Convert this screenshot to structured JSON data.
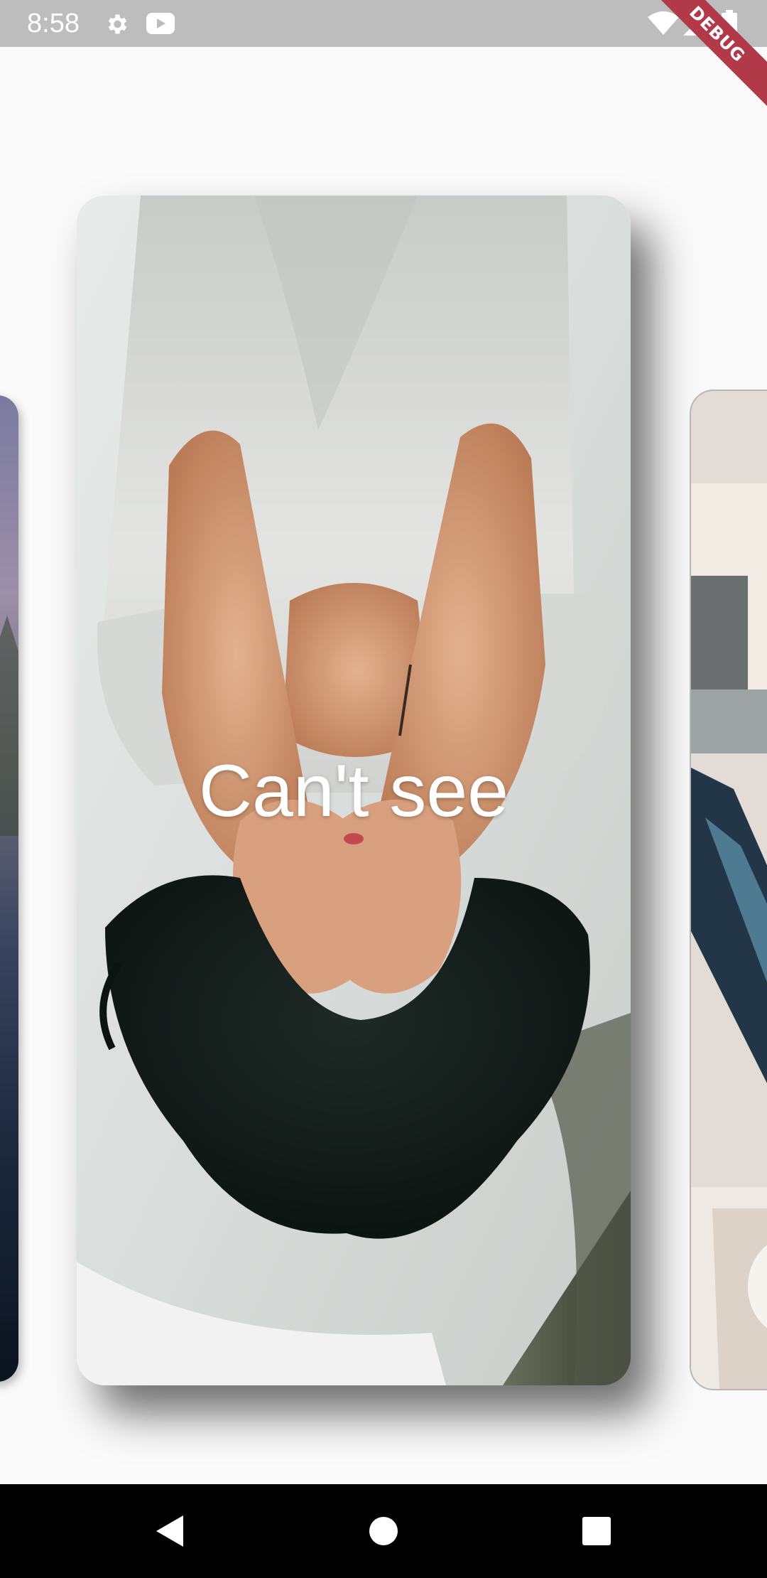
{
  "status_bar": {
    "time": "8:58",
    "icons": [
      "gear-icon",
      "youtube-icon",
      "wifi-icon",
      "signal-icon",
      "battery-icon"
    ],
    "debug_banner": "DEBUG"
  },
  "carousel": {
    "cards": [
      {
        "id": "previous",
        "caption": ""
      },
      {
        "id": "current",
        "caption": "Can't see"
      },
      {
        "id": "next",
        "caption": ""
      }
    ]
  },
  "nav_bar": {
    "buttons": [
      "back-icon",
      "home-icon",
      "recents-icon"
    ]
  },
  "colors": {
    "status_bar_bg": "#bdbdbd",
    "page_bg": "#fafafa",
    "nav_bar_bg": "#000000",
    "debug_ribbon": "#b23a48"
  }
}
